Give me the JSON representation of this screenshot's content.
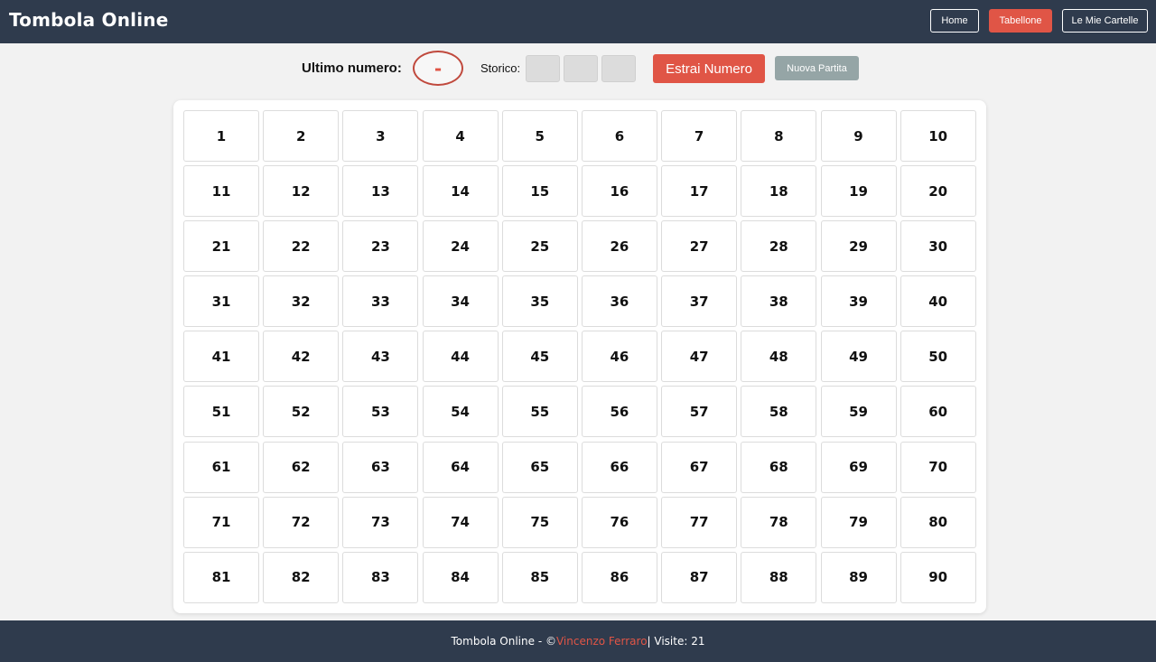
{
  "header": {
    "title": "Tombola Online",
    "nav": [
      {
        "label": "Home",
        "active": false
      },
      {
        "label": "Tabellone",
        "active": true
      },
      {
        "label": "Le Mie Cartelle",
        "active": false
      }
    ]
  },
  "controls": {
    "last_number_label": "Ultimo numero:",
    "last_number_value": "-",
    "history_label": "Storico:",
    "history": [
      "",
      "",
      ""
    ],
    "draw_button": "Estrai Numero",
    "new_game_button": "Nuova Partita"
  },
  "board": {
    "numbers": [
      1,
      2,
      3,
      4,
      5,
      6,
      7,
      8,
      9,
      10,
      11,
      12,
      13,
      14,
      15,
      16,
      17,
      18,
      19,
      20,
      21,
      22,
      23,
      24,
      25,
      26,
      27,
      28,
      29,
      30,
      31,
      32,
      33,
      34,
      35,
      36,
      37,
      38,
      39,
      40,
      41,
      42,
      43,
      44,
      45,
      46,
      47,
      48,
      49,
      50,
      51,
      52,
      53,
      54,
      55,
      56,
      57,
      58,
      59,
      60,
      61,
      62,
      63,
      64,
      65,
      66,
      67,
      68,
      69,
      70,
      71,
      72,
      73,
      74,
      75,
      76,
      77,
      78,
      79,
      80,
      81,
      82,
      83,
      84,
      85,
      86,
      87,
      88,
      89,
      90
    ],
    "drawn": []
  },
  "footer": {
    "prefix": "Tombola Online - © ",
    "author": "Vincenzo Ferraro",
    "suffix": " | Visite: 21"
  },
  "colors": {
    "header_bg": "#2f3b4d",
    "accent": "#e05546",
    "secondary": "#95a5a6",
    "page_bg": "#f2f2f2"
  }
}
